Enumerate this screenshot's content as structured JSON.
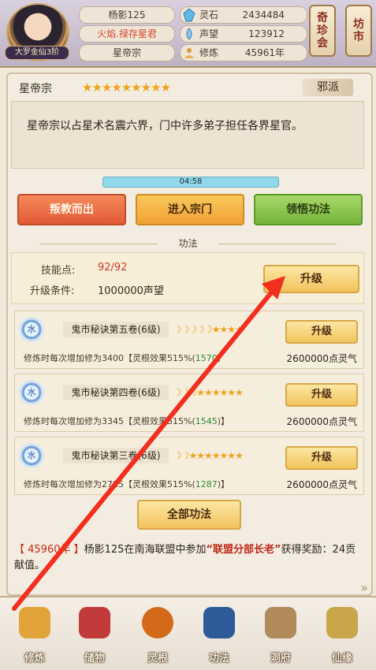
{
  "header": {
    "player_name": "杨影125",
    "flame_title": "火焰.禄存星君",
    "sect": "星帝宗",
    "rank": "大罗金仙3阶",
    "resources": [
      {
        "icon": "spirit-stone-icon",
        "label": "灵石",
        "value": "2434484"
      },
      {
        "icon": "reputation-icon",
        "label": "声望",
        "value": "123912"
      },
      {
        "icon": "cultivation-icon",
        "label": "修炼",
        "value": "45961年"
      }
    ],
    "right_buttons": [
      {
        "label": [
          "奇",
          "珍",
          "会"
        ]
      },
      {
        "label": [
          "坊",
          "市"
        ]
      }
    ]
  },
  "sect_info": {
    "name": "星帝宗",
    "stars": "★★★★★★★★★",
    "alignment": "邪派",
    "description": "星帝宗以占星术名震六界，门中许多弟子担任各界星官。",
    "timer": "04:58",
    "buttons": [
      "叛教而出",
      "进入宗门",
      "领悟功法"
    ]
  },
  "techniques": {
    "section_title": "功法",
    "skill_points_label": "技能点:",
    "skill_points_value": "92/92",
    "upgrade_condition_label": "升级条件:",
    "upgrade_condition_value": "1000000声望",
    "upgrade_label": "升级",
    "items": [
      {
        "element": "水",
        "name": "鬼市秘诀第五卷(6级)",
        "stars": "☽☽☽☽☽★★★★",
        "desc_pre": "修炼时每次增加修为3400【灵根效果515%(",
        "desc_green": "1570",
        "desc_post": ")",
        "cost": "2600000点灵气"
      },
      {
        "element": "水",
        "name": "鬼市秘诀第四卷(6级)",
        "stars": "☽☽☽★★★★★★",
        "desc_pre": "修炼时每次增加修为3345【灵根效果515%(",
        "desc_green": "1545",
        "desc_post": ")】",
        "cost": "2600000点灵气"
      },
      {
        "element": "水",
        "name": "鬼市秘诀第三卷(6级)",
        "stars": "☽☽★★★★★★★",
        "desc_pre": "修炼时每次增加修为2785【灵根效果515%(",
        "desc_green": "1287",
        "desc_post": ")】",
        "cost": "2600000点灵气"
      }
    ],
    "all_label": "全部功法"
  },
  "news": {
    "year": "【 45960年 】",
    "text_a": "杨影125在南海联盟中参加",
    "quote": "“联盟分部长老”",
    "text_b": "获得奖励：24贡献值。"
  },
  "nav": [
    {
      "label": "修炼",
      "icon": "cultivate-icon",
      "color": "#e2a338"
    },
    {
      "label": "储物",
      "icon": "storage-bag-icon",
      "color": "#c23b3b"
    },
    {
      "label": "灵根",
      "icon": "spirit-root-icon",
      "color": "#d26a1a"
    },
    {
      "label": "功法",
      "icon": "technique-book-icon",
      "color": "#2d5b9a"
    },
    {
      "label": "洞府",
      "icon": "cave-dwelling-icon",
      "color": "#b08a5a"
    },
    {
      "label": "仙缘",
      "icon": "immortal-fate-icon",
      "color": "#c9a64a"
    }
  ]
}
